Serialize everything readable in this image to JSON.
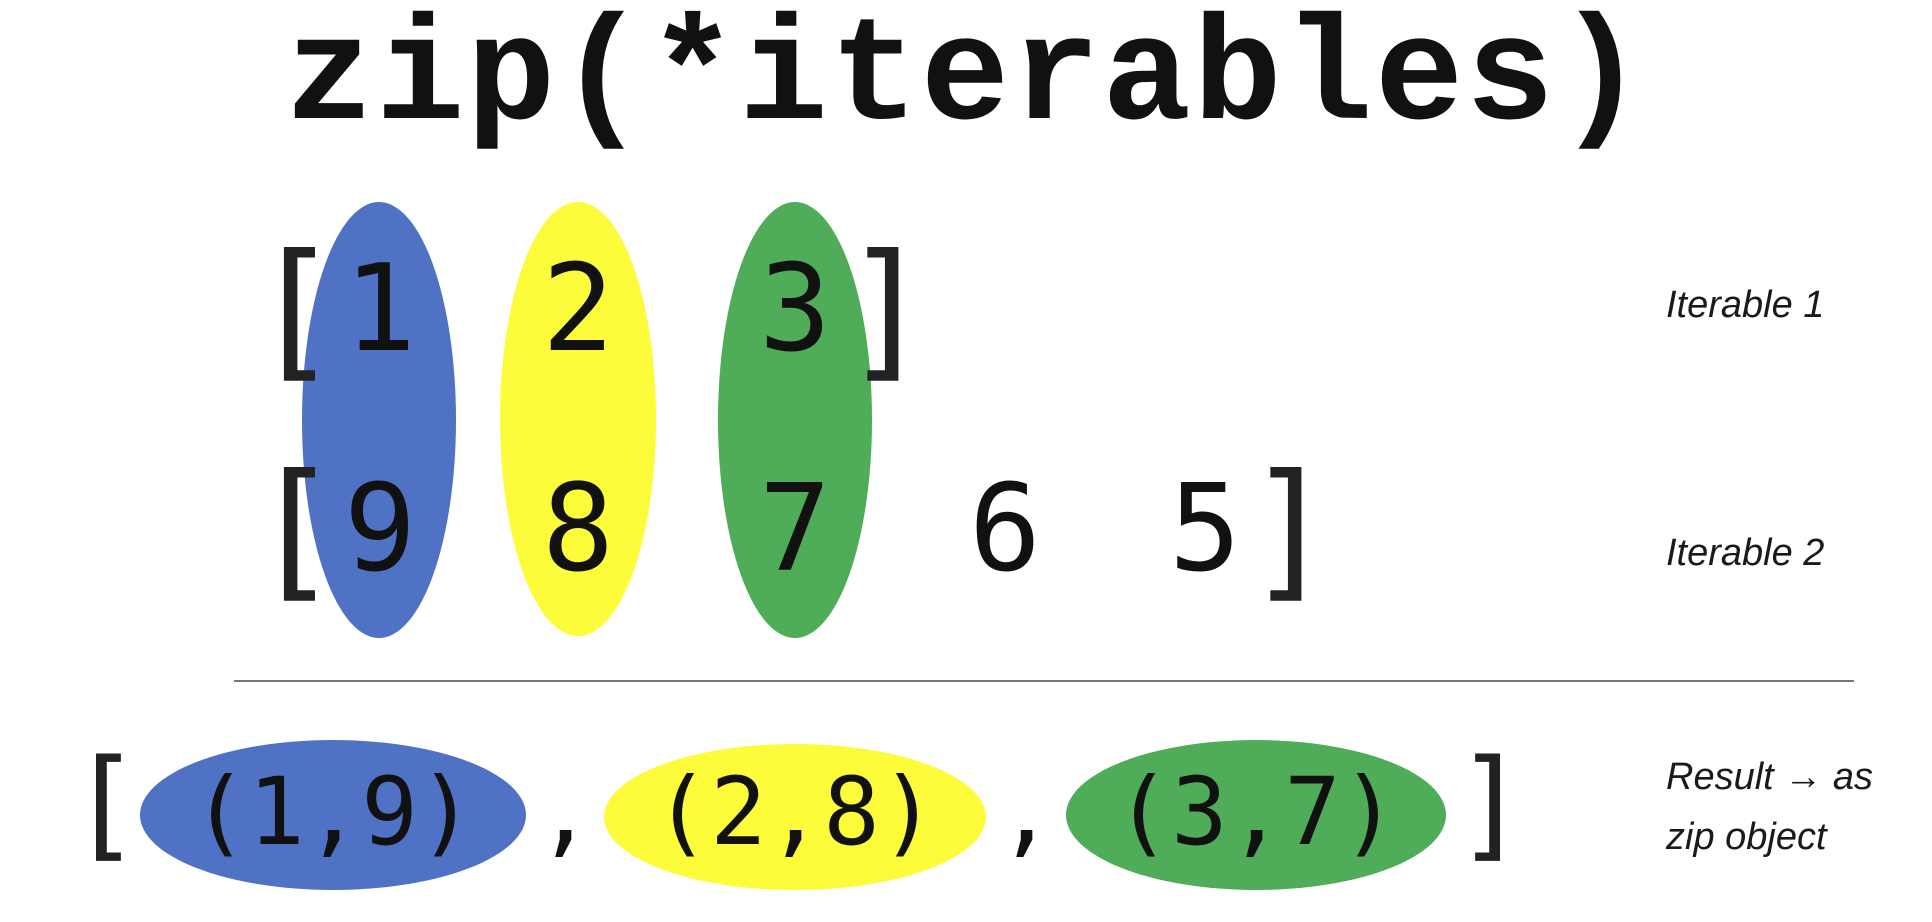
{
  "title": "zip(*iterables)",
  "colors": {
    "blue": "#4f72c4",
    "yellow": "#fdfc3a",
    "green": "#4fac58"
  },
  "iterable1": {
    "open": "[",
    "close": "]",
    "items": [
      "1",
      "2",
      "3"
    ],
    "label": "Iterable 1"
  },
  "iterable2": {
    "open": "[",
    "close": "]",
    "items": [
      "9",
      "8",
      "7",
      "6",
      "5"
    ],
    "label": "Iterable 2"
  },
  "result": {
    "open": "[",
    "close": "]",
    "tuples": [
      "(1,9)",
      "(2,8)",
      "(3,7)"
    ],
    "separator": ",",
    "label_line1": "Result → as",
    "label_line2": "zip object"
  }
}
